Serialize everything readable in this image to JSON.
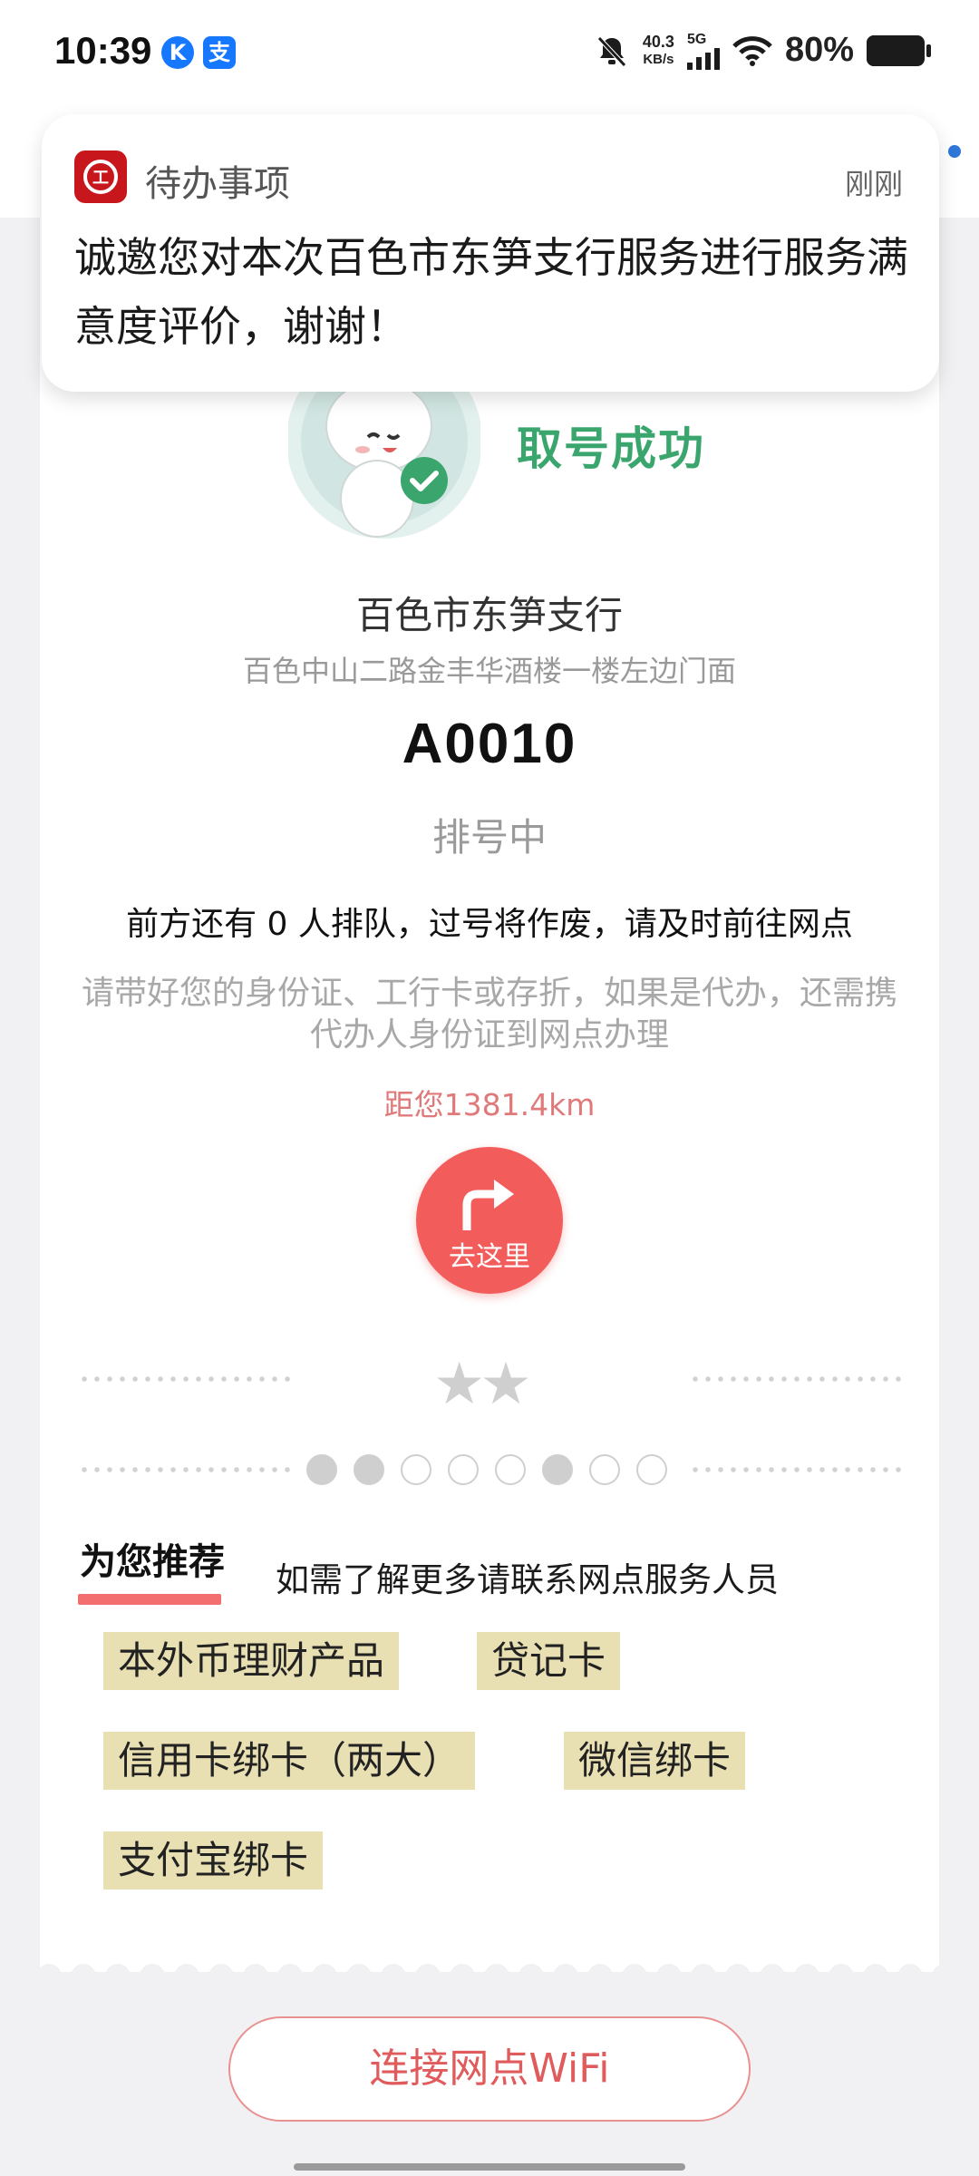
{
  "status_bar": {
    "time": "10:39",
    "app_icons": [
      "K",
      "支"
    ],
    "net_speed_value": "40.3",
    "net_speed_unit": "KB/s",
    "network_type": "5G",
    "battery_text": "80%",
    "battery_level": 0.8
  },
  "notification": {
    "app_name": "待办事项",
    "time": "刚刚",
    "body": "诚邀您对本次百色市东笋支行服务进行服务满意度评价，谢谢！"
  },
  "result": {
    "status_title": "取号成功",
    "branch_name": "百色市东笋支行",
    "branch_address": "百色中山二路金丰华酒楼一楼左边门面",
    "ticket_number": "A0010",
    "queue_status": "排号中",
    "queue_info": "前方还有 0 人排队，过号将作废，请及时前往网点",
    "reminder": "请带好您的身份证、工行卡或存折，如果是代办，还需携代办人身份证到网点办理",
    "distance": "距您1381.4km",
    "navigate_label": "去这里"
  },
  "rating": {
    "stars_text": "★★",
    "pager_dots": [
      true,
      true,
      false,
      false,
      false,
      true,
      false,
      false
    ]
  },
  "recommend": {
    "title": "为您推荐",
    "note": "如需了解更多请联系网点服务人员",
    "tags": [
      "本外币理财产品",
      "贷记卡",
      "信用卡绑卡（两大）",
      "微信绑卡",
      "支付宝绑卡"
    ]
  },
  "wifi_button": "连接网点WiFi",
  "colors": {
    "accent_red": "#f25d5b",
    "success_green": "#3aa66e",
    "tag_bg": "#e8dfb3",
    "icbc_red": "#c8161d"
  }
}
